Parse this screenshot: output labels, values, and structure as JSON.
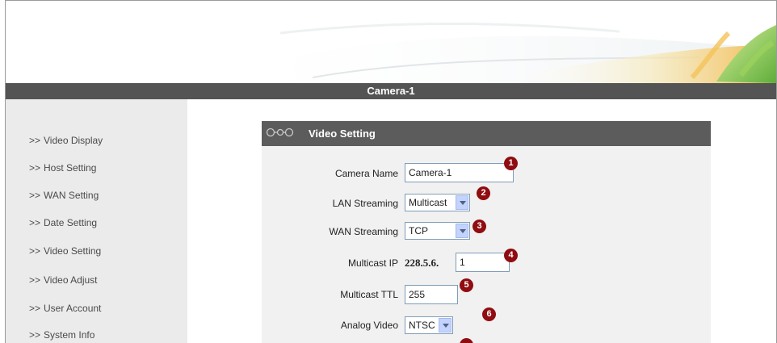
{
  "window": {
    "title": "Camera-1"
  },
  "sidebar": {
    "items": [
      {
        "arrows": ">>",
        "label": "Video Display"
      },
      {
        "arrows": ">>",
        "label": "Host Setting"
      },
      {
        "arrows": ">>",
        "label": "WAN Setting"
      },
      {
        "arrows": ">>",
        "label": "Date Setting"
      },
      {
        "arrows": ">>",
        "label": "Video Setting"
      },
      {
        "arrows": ">>",
        "label": "Video Adjust"
      },
      {
        "arrows": ">>",
        "label": "User Account"
      },
      {
        "arrows": ">>",
        "label": "System Info"
      }
    ]
  },
  "panel": {
    "title": "Video Setting",
    "fields": {
      "camera_name": {
        "label": "Camera Name",
        "value": "Camera-1",
        "badge": "1"
      },
      "lan_streaming": {
        "label": "LAN Streaming",
        "value": "Multicast",
        "badge": "2"
      },
      "wan_streaming": {
        "label": "WAN Streaming",
        "value": "TCP",
        "badge": "3"
      },
      "multicast_ip": {
        "label": "Multicast IP",
        "prefix": "228.5.6.",
        "value": "1",
        "badge": "4"
      },
      "multicast_ttl": {
        "label": "Multicast TTL",
        "value": "255",
        "badge": "5"
      },
      "analog_video": {
        "label": "Analog Video",
        "value": "NTSC",
        "badge": "6"
      }
    }
  },
  "colors": {
    "title_bar": "#545454",
    "sidebar_bg": "#ebebeb",
    "panel_header": "#5c5c5c",
    "panel_bg": "#f1f1f1",
    "badge": "#8f0c10"
  }
}
